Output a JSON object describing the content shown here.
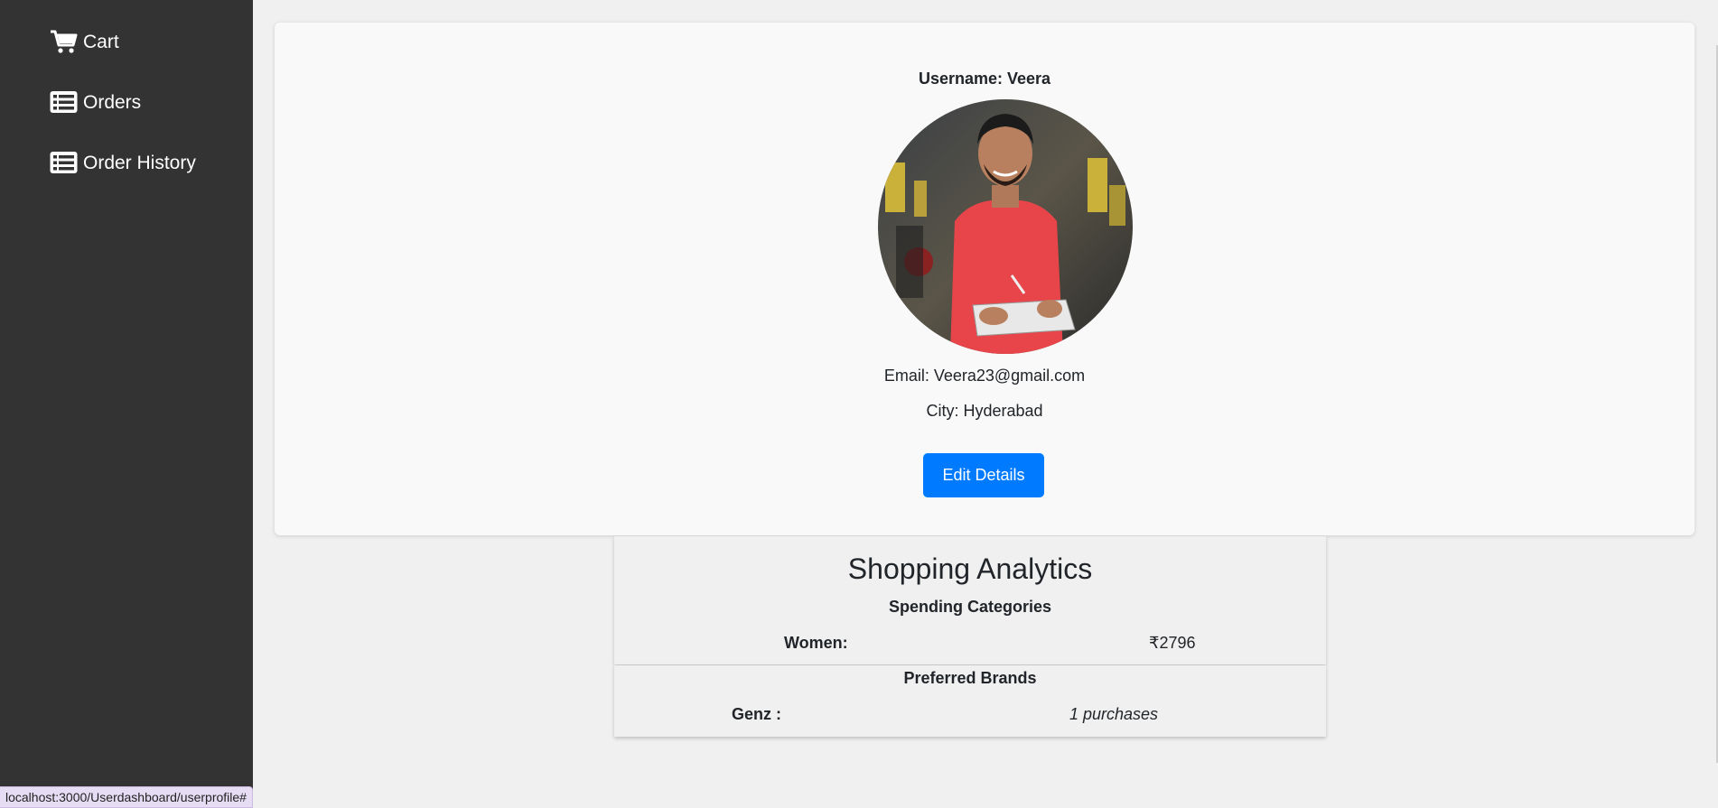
{
  "sidebar": {
    "items": [
      {
        "label": "Cart",
        "icon": "cart-icon"
      },
      {
        "label": "Orders",
        "icon": "list-icon"
      },
      {
        "label": "Order History",
        "icon": "list-icon"
      }
    ]
  },
  "profile": {
    "username": "Username: Veera",
    "email": "Email: Veera23@gmail.com",
    "city": "City: Hyderabad",
    "edit_label": "Edit Details",
    "avatar_alt": "Profile photo"
  },
  "analytics": {
    "title": "Shopping Analytics",
    "categories_heading": "Spending Categories",
    "categories": [
      {
        "label": "Women:",
        "value": "₹2796"
      }
    ],
    "brands_heading": "Preferred Brands",
    "brands": [
      {
        "label": "Genz :",
        "value": "1 purchases"
      }
    ]
  },
  "status_bar": {
    "url": "localhost:3000/Userdashboard/userprofile#"
  },
  "colors": {
    "sidebar_bg": "#333333",
    "primary_button": "#007bff",
    "page_bg": "#f0f0f0"
  }
}
